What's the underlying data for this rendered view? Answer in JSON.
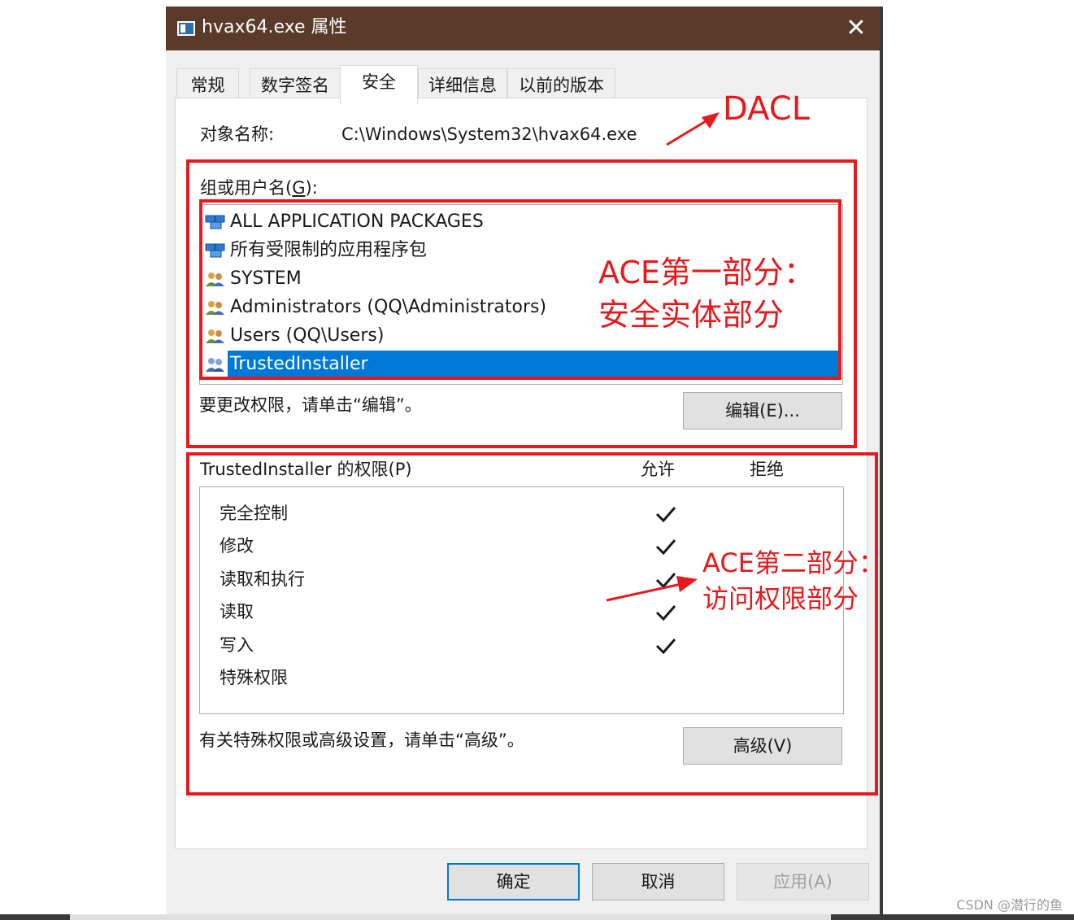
{
  "window": {
    "title": "hvax64.exe 属性",
    "close_glyph": "✕"
  },
  "tabs": [
    {
      "label": "常规"
    },
    {
      "label": "数字签名"
    },
    {
      "label": "安全"
    },
    {
      "label": "详细信息"
    },
    {
      "label": "以前的版本"
    }
  ],
  "object": {
    "label": "对象名称:",
    "value": "C:\\Windows\\System32\\hvax64.exe"
  },
  "groups": {
    "label": "组或用户名(",
    "label_key": "G",
    "label_suffix": "):",
    "items": [
      {
        "name": "ALL APPLICATION PACKAGES",
        "icon": "package-group-icon"
      },
      {
        "name": "所有受限制的应用程序包",
        "icon": "package-group-icon"
      },
      {
        "name": "SYSTEM",
        "icon": "users-icon"
      },
      {
        "name": "Administrators (QQ\\Administrators)",
        "icon": "users-icon"
      },
      {
        "name": "Users (QQ\\Users)",
        "icon": "users-icon"
      },
      {
        "name": "TrustedInstaller",
        "icon": "users-icon",
        "selected": true
      }
    ],
    "hint": "要更改权限，请单击“编辑”。",
    "edit_button": "编辑(E)..."
  },
  "permissions": {
    "label": "TrustedInstaller 的权限(P)",
    "allow_header": "允许",
    "deny_header": "拒绝",
    "rows": [
      {
        "name": "完全控制",
        "allow": true,
        "deny": false
      },
      {
        "name": "修改",
        "allow": true,
        "deny": false
      },
      {
        "name": "读取和执行",
        "allow": true,
        "deny": false
      },
      {
        "name": "读取",
        "allow": true,
        "deny": false
      },
      {
        "name": "写入",
        "allow": true,
        "deny": false
      },
      {
        "name": "特殊权限",
        "allow": false,
        "deny": false
      }
    ],
    "hint": "有关特殊权限或高级设置，请单击“高级”。",
    "advanced_button": "高级(V)"
  },
  "footer": {
    "ok": "确定",
    "cancel": "取消",
    "apply": "应用(A)"
  },
  "annotations": {
    "dacl": "DACL",
    "ace1_line1": "ACE第一部分：",
    "ace1_line2": "安全实体部分",
    "ace2_line1": "ACE第二部分：",
    "ace2_line2": "访问权限部分",
    "color": "#e8191d"
  },
  "watermark": "CSDN @潜行的鱼"
}
